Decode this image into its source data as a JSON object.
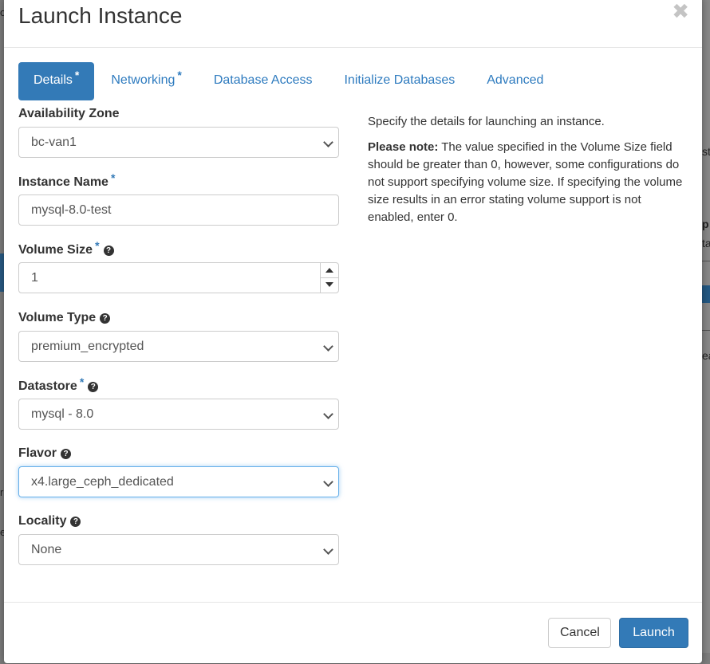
{
  "modal": {
    "title": "Launch Instance",
    "close_symbol": "✖"
  },
  "tabs": [
    {
      "label": "Details",
      "required": "*",
      "active": true
    },
    {
      "label": "Networking",
      "required": "*",
      "active": false
    },
    {
      "label": "Database Access",
      "required": "",
      "active": false
    },
    {
      "label": "Initialize Databases",
      "required": "",
      "active": false
    },
    {
      "label": "Advanced",
      "required": "",
      "active": false
    }
  ],
  "fields": {
    "availability_zone": {
      "label": "Availability Zone",
      "value": "bc-van1"
    },
    "instance_name": {
      "label": "Instance Name",
      "required": "*",
      "value": "mysql-8.0-test"
    },
    "volume_size": {
      "label": "Volume Size",
      "required": "*",
      "value": "1"
    },
    "volume_type": {
      "label": "Volume Type",
      "value": "premium_encrypted"
    },
    "datastore": {
      "label": "Datastore",
      "required": "*",
      "value": "mysql - 8.0"
    },
    "flavor": {
      "label": "Flavor",
      "value": "x4.large_ceph_dedicated"
    },
    "locality": {
      "label": "Locality",
      "value": "None"
    }
  },
  "help_icon": "?",
  "description": {
    "intro": "Specify the details for launching an instance.",
    "note_label": "Please note:",
    "note_text": " The value specified in the Volume Size field should be greater than 0, however, some configurations do not support specifying volume size. If specifying the volume size results in an error stating volume support is not enabled, enter 0."
  },
  "footer": {
    "cancel_label": "Cancel",
    "launch_label": "Launch"
  },
  "background": {
    "fragments": [
      "p",
      "st",
      "p",
      "ta",
      "ea"
    ],
    "left_fragments": [
      "o",
      "r",
      "e"
    ]
  }
}
